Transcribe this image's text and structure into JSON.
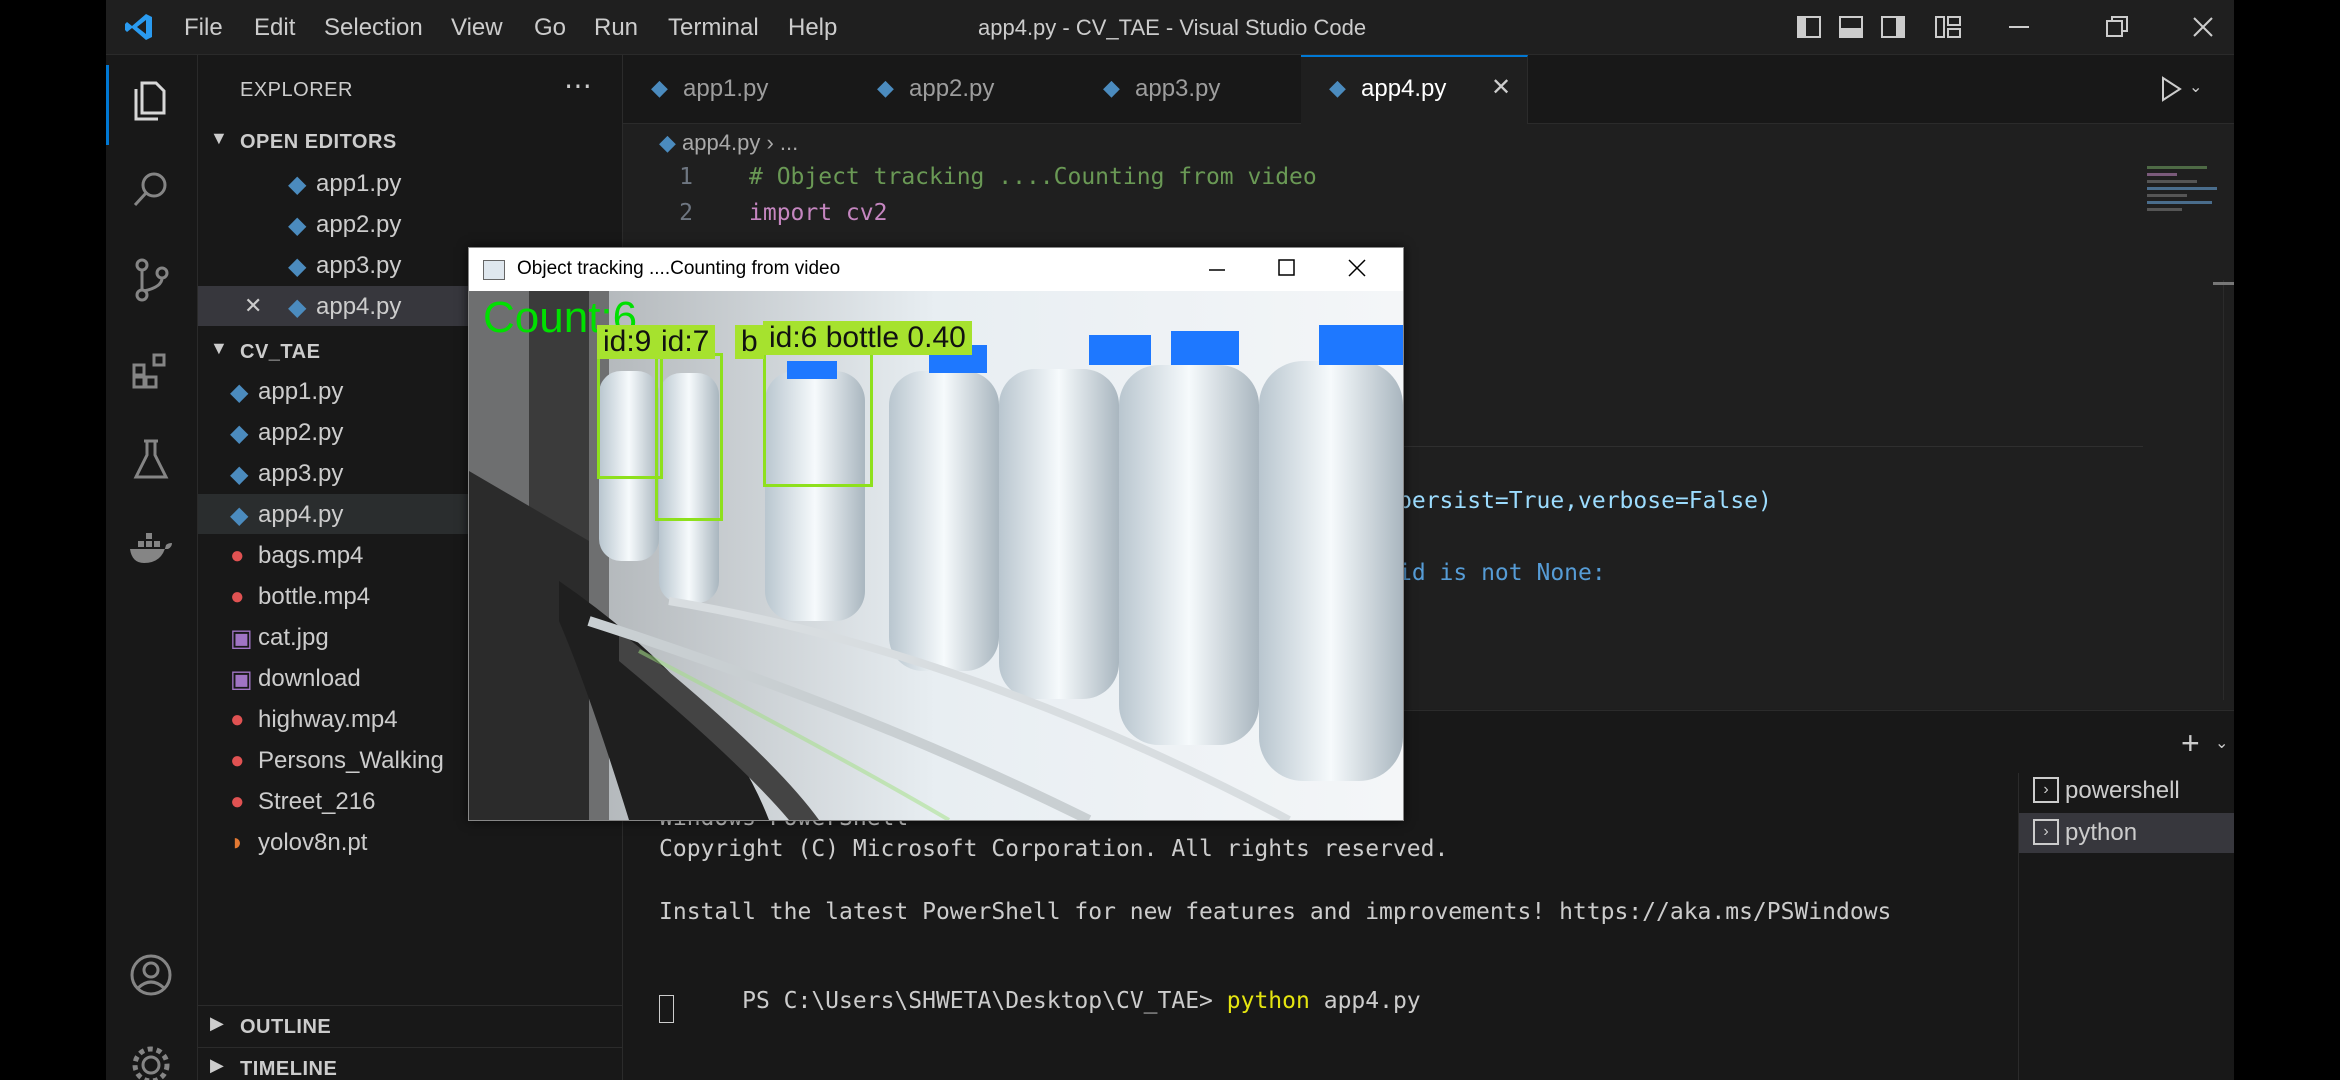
{
  "window": {
    "title": "app4.py - CV_TAE - Visual Studio Code",
    "menu": [
      "File",
      "Edit",
      "Selection",
      "View",
      "Go",
      "Run",
      "Terminal",
      "Help"
    ]
  },
  "activity_bar": {
    "icons": [
      "files-icon",
      "search-icon",
      "source-control-icon",
      "extensions-icon",
      "testing-icon",
      "docker-icon",
      "account-icon",
      "settings-gear-icon"
    ]
  },
  "sidebar": {
    "title": "EXPLORER",
    "open_editors_label": "OPEN EDITORS",
    "open_editors": [
      "app1.py",
      "app2.py",
      "app3.py",
      "app4.py"
    ],
    "folder_label": "CV_TAE",
    "files": [
      {
        "name": "app1.py",
        "type": "python"
      },
      {
        "name": "app2.py",
        "type": "python"
      },
      {
        "name": "app3.py",
        "type": "python"
      },
      {
        "name": "app4.py",
        "type": "python"
      },
      {
        "name": "bags.mp4",
        "type": "video"
      },
      {
        "name": "bottle.mp4",
        "type": "video"
      },
      {
        "name": "cat.jpg",
        "type": "image"
      },
      {
        "name": "download",
        "type": "image"
      },
      {
        "name": "highway.mp4",
        "type": "video"
      },
      {
        "name": "Persons_Walking",
        "type": "video"
      },
      {
        "name": "Street_216",
        "type": "video"
      },
      {
        "name": "yolov8n.pt",
        "type": "model"
      }
    ],
    "outline_label": "OUTLINE",
    "timeline_label": "TIMELINE"
  },
  "tabs": [
    {
      "label": "app1.py",
      "active": false
    },
    {
      "label": "app2.py",
      "active": false
    },
    {
      "label": "app3.py",
      "active": false
    },
    {
      "label": "app4.py",
      "active": true
    }
  ],
  "breadcrumb": {
    "file": "app4.py",
    "rest": "..."
  },
  "editor": {
    "lines": [
      {
        "n": "1",
        "text": "# Object tracking ....Counting from video"
      },
      {
        "n": "2",
        "text": "import cv2"
      }
    ],
    "fragment_persist": "persist=True,verbose=False)",
    "fragment_id": "id is not None:"
  },
  "terminal": {
    "header_line": "Windows PowerShell",
    "copyright": "Copyright (C) Microsoft Corporation. All rights reserved.",
    "install_msg": "Install the latest PowerShell for new features and improvements! https://aka.ms/PSWindows",
    "prompt": "PS C:\\Users\\SHWETA\\Desktop\\CV_TAE>",
    "command": "python",
    "command_arg": "app4.py",
    "sessions": [
      "powershell",
      "python"
    ]
  },
  "cv_window": {
    "title": "Object tracking ....Counting from video",
    "count_text": "Count:6",
    "labels": [
      "id:9",
      "id:7",
      "b",
      "id:6  bottle  0.40"
    ]
  },
  "colors": {
    "accent": "#0078d4",
    "detection_green": "#8ee01d",
    "count_green": "#00e000",
    "cap_blue": "#1e78ff"
  }
}
